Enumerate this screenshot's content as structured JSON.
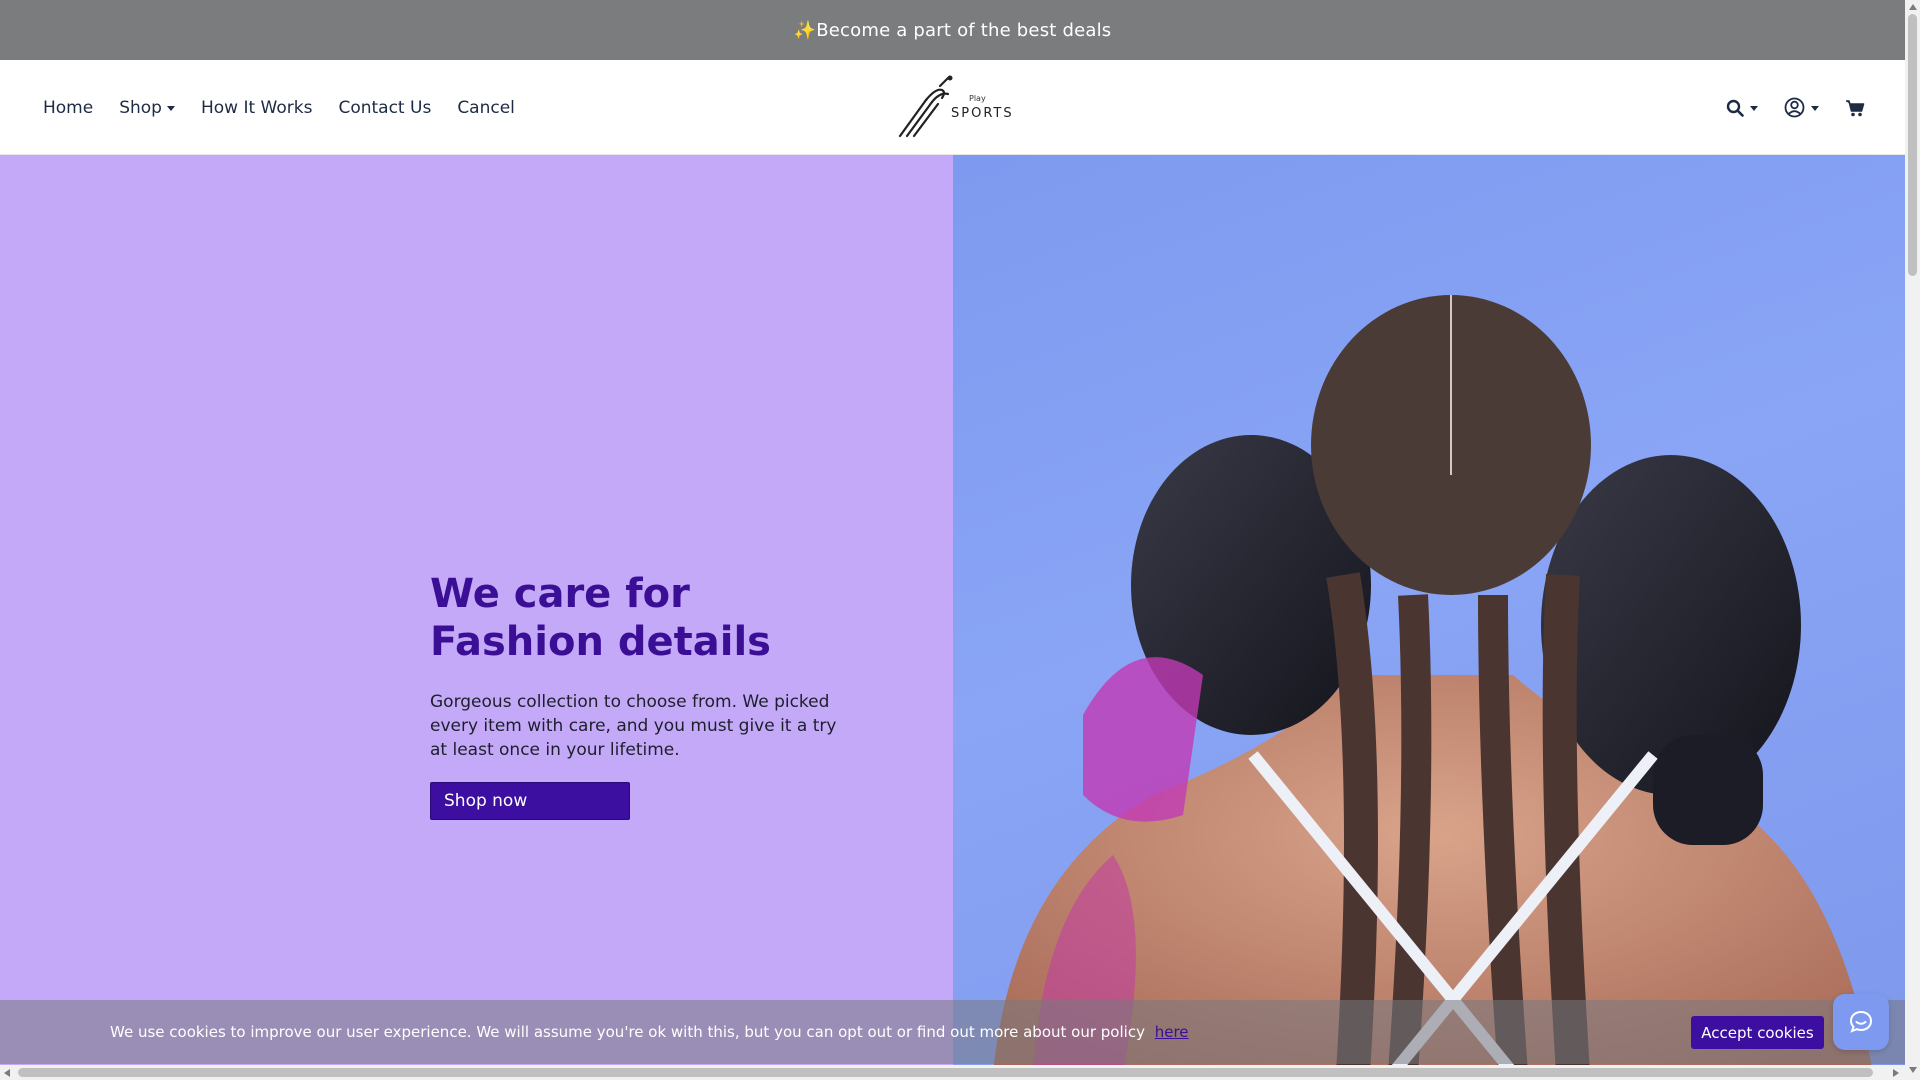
{
  "announcement": {
    "text": "✨Become a part of the best deals"
  },
  "nav": {
    "items": [
      {
        "label": "Home",
        "dropdown": false
      },
      {
        "label": "Shop",
        "dropdown": true
      },
      {
        "label": "How It Works",
        "dropdown": false
      },
      {
        "label": "Contact Us",
        "dropdown": false
      },
      {
        "label": "Cancel",
        "dropdown": false
      }
    ]
  },
  "logo": {
    "line1": "Play",
    "line2": "SPORTS"
  },
  "tools": {
    "search_icon": "search-icon",
    "account_icon": "user-circle-icon",
    "cart_icon": "shopping-cart-icon"
  },
  "hero": {
    "headline_line1": "We care for",
    "headline_line2": "Fashion details",
    "subtext": "Gorgeous collection to choose from. We picked every item with care, and you must give it a try at least once in your lifetime.",
    "cta_label": "Shop now",
    "image_subject": "boxer-with-braids-photo"
  },
  "cookie": {
    "text": "We use cookies to improve our user experience. We will assume you're ok with this, but you can opt out or find out more about our policy",
    "link_label": "here",
    "accept_label": "Accept cookies"
  },
  "chat": {
    "icon": "chat-bubble-icon"
  },
  "colors": {
    "announcement_bg": "#7b7c7e",
    "hero_left_bg": "#c4a9f8",
    "hero_right_bg": "#7d9af0",
    "accent": "#3d0fa0",
    "headline": "#3a0f96"
  }
}
